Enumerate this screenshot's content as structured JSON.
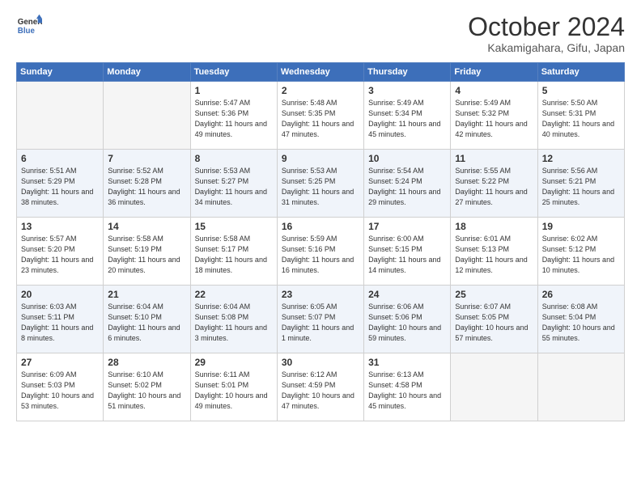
{
  "header": {
    "logo_line1": "General",
    "logo_line2": "Blue",
    "month": "October 2024",
    "location": "Kakamigahara, Gifu, Japan"
  },
  "weekdays": [
    "Sunday",
    "Monday",
    "Tuesday",
    "Wednesday",
    "Thursday",
    "Friday",
    "Saturday"
  ],
  "weeks": [
    [
      {
        "day": "",
        "info": ""
      },
      {
        "day": "",
        "info": ""
      },
      {
        "day": "1",
        "info": "Sunrise: 5:47 AM\nSunset: 5:36 PM\nDaylight: 11 hours and 49 minutes."
      },
      {
        "day": "2",
        "info": "Sunrise: 5:48 AM\nSunset: 5:35 PM\nDaylight: 11 hours and 47 minutes."
      },
      {
        "day": "3",
        "info": "Sunrise: 5:49 AM\nSunset: 5:34 PM\nDaylight: 11 hours and 45 minutes."
      },
      {
        "day": "4",
        "info": "Sunrise: 5:49 AM\nSunset: 5:32 PM\nDaylight: 11 hours and 42 minutes."
      },
      {
        "day": "5",
        "info": "Sunrise: 5:50 AM\nSunset: 5:31 PM\nDaylight: 11 hours and 40 minutes."
      }
    ],
    [
      {
        "day": "6",
        "info": "Sunrise: 5:51 AM\nSunset: 5:29 PM\nDaylight: 11 hours and 38 minutes."
      },
      {
        "day": "7",
        "info": "Sunrise: 5:52 AM\nSunset: 5:28 PM\nDaylight: 11 hours and 36 minutes."
      },
      {
        "day": "8",
        "info": "Sunrise: 5:53 AM\nSunset: 5:27 PM\nDaylight: 11 hours and 34 minutes."
      },
      {
        "day": "9",
        "info": "Sunrise: 5:53 AM\nSunset: 5:25 PM\nDaylight: 11 hours and 31 minutes."
      },
      {
        "day": "10",
        "info": "Sunrise: 5:54 AM\nSunset: 5:24 PM\nDaylight: 11 hours and 29 minutes."
      },
      {
        "day": "11",
        "info": "Sunrise: 5:55 AM\nSunset: 5:22 PM\nDaylight: 11 hours and 27 minutes."
      },
      {
        "day": "12",
        "info": "Sunrise: 5:56 AM\nSunset: 5:21 PM\nDaylight: 11 hours and 25 minutes."
      }
    ],
    [
      {
        "day": "13",
        "info": "Sunrise: 5:57 AM\nSunset: 5:20 PM\nDaylight: 11 hours and 23 minutes."
      },
      {
        "day": "14",
        "info": "Sunrise: 5:58 AM\nSunset: 5:19 PM\nDaylight: 11 hours and 20 minutes."
      },
      {
        "day": "15",
        "info": "Sunrise: 5:58 AM\nSunset: 5:17 PM\nDaylight: 11 hours and 18 minutes."
      },
      {
        "day": "16",
        "info": "Sunrise: 5:59 AM\nSunset: 5:16 PM\nDaylight: 11 hours and 16 minutes."
      },
      {
        "day": "17",
        "info": "Sunrise: 6:00 AM\nSunset: 5:15 PM\nDaylight: 11 hours and 14 minutes."
      },
      {
        "day": "18",
        "info": "Sunrise: 6:01 AM\nSunset: 5:13 PM\nDaylight: 11 hours and 12 minutes."
      },
      {
        "day": "19",
        "info": "Sunrise: 6:02 AM\nSunset: 5:12 PM\nDaylight: 11 hours and 10 minutes."
      }
    ],
    [
      {
        "day": "20",
        "info": "Sunrise: 6:03 AM\nSunset: 5:11 PM\nDaylight: 11 hours and 8 minutes."
      },
      {
        "day": "21",
        "info": "Sunrise: 6:04 AM\nSunset: 5:10 PM\nDaylight: 11 hours and 6 minutes."
      },
      {
        "day": "22",
        "info": "Sunrise: 6:04 AM\nSunset: 5:08 PM\nDaylight: 11 hours and 3 minutes."
      },
      {
        "day": "23",
        "info": "Sunrise: 6:05 AM\nSunset: 5:07 PM\nDaylight: 11 hours and 1 minute."
      },
      {
        "day": "24",
        "info": "Sunrise: 6:06 AM\nSunset: 5:06 PM\nDaylight: 10 hours and 59 minutes."
      },
      {
        "day": "25",
        "info": "Sunrise: 6:07 AM\nSunset: 5:05 PM\nDaylight: 10 hours and 57 minutes."
      },
      {
        "day": "26",
        "info": "Sunrise: 6:08 AM\nSunset: 5:04 PM\nDaylight: 10 hours and 55 minutes."
      }
    ],
    [
      {
        "day": "27",
        "info": "Sunrise: 6:09 AM\nSunset: 5:03 PM\nDaylight: 10 hours and 53 minutes."
      },
      {
        "day": "28",
        "info": "Sunrise: 6:10 AM\nSunset: 5:02 PM\nDaylight: 10 hours and 51 minutes."
      },
      {
        "day": "29",
        "info": "Sunrise: 6:11 AM\nSunset: 5:01 PM\nDaylight: 10 hours and 49 minutes."
      },
      {
        "day": "30",
        "info": "Sunrise: 6:12 AM\nSunset: 4:59 PM\nDaylight: 10 hours and 47 minutes."
      },
      {
        "day": "31",
        "info": "Sunrise: 6:13 AM\nSunset: 4:58 PM\nDaylight: 10 hours and 45 minutes."
      },
      {
        "day": "",
        "info": ""
      },
      {
        "day": "",
        "info": ""
      }
    ]
  ]
}
